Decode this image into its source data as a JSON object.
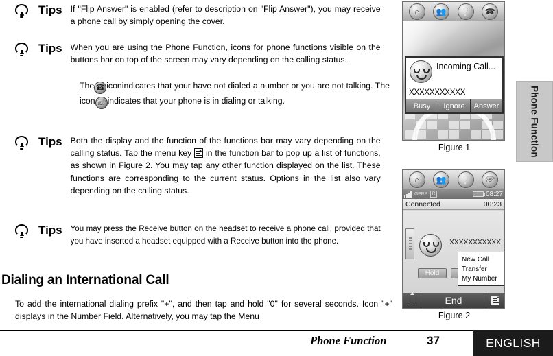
{
  "tips": [
    {
      "label": "Tips",
      "text": "If \"Flip Answer\" is enabled (refer to description on \"Flip Answer\"), you may receive a phone call by simply opening the cover."
    },
    {
      "label": "Tips",
      "text": "When you are using the Phone Function, icons for phone functions visible on the buttons bar on top of the screen may vary depending on the calling status."
    },
    {
      "label": "Tips",
      "text": "Both the display and the function of the functions bar may vary depending on the calling status. Tap the menu key"
    },
    {
      "label": "Tips",
      "text": "You may press the Receive button on the headset to receive a phone call, provided that you have inserted a headset equipped with a Receive button into the phone."
    }
  ],
  "icon_paragraph": {
    "part1": "The",
    "part2": "iconindicates that your have not dialed a number or you are not talking. The icon",
    "part3": "indicates that your phone is in dialing or talking."
  },
  "tip3_rest": "in the function bar to pop up a list of functions, as shown in Figure 2. You may tap any other function displayed on the list. These functions are corresponding to the current status. Options in the list also vary depending on the calling status.",
  "heading": "Dialing an International Call",
  "body_paragraph": "To add the international dialing prefix \"+\", and then tap and hold \"0\" for several seconds. Icon \"+\" displays in the Number Field. Alternatively, you may tap the Menu",
  "footer": {
    "section": "Phone Function",
    "page": "37",
    "language": "ENGLISH"
  },
  "side_tab": {
    "label": "Phone Function"
  },
  "figure1": {
    "caption": "Figure 1",
    "buttons": [
      "home-icon",
      "contacts-icon",
      "question-icon",
      "hangup-icon"
    ],
    "dialog": {
      "title": "Incoming Call...",
      "number": "XXXXXXXXXXX",
      "actions": [
        "Busy",
        "Ignore",
        "Answer"
      ]
    }
  },
  "figure2": {
    "caption": "Figure 2",
    "buttons": [
      "home-icon",
      "contacts-icon",
      "question-icon",
      "call-icon"
    ],
    "statusbar": {
      "network": "GPRS",
      "indicator": "R",
      "time": "08:27"
    },
    "call_status": "Connected",
    "call_duration": "00:23",
    "number": "XXXXXXXXXXX",
    "hold_label": "Hold",
    "popup_items": [
      "New Call",
      "Transfer",
      "My Number"
    ],
    "function_bar": {
      "left_icon": "export-icon",
      "center": "End",
      "right_icon": "menu-key-icon"
    }
  },
  "colors": {
    "footer_bg": "#1b1b1b",
    "side_tab_bg": "#c8c8c8",
    "text": "#000000"
  }
}
